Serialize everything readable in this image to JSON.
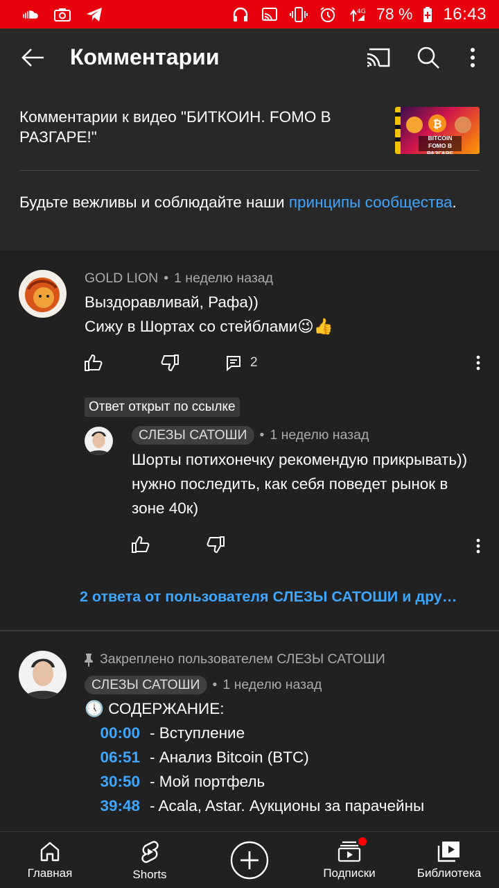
{
  "status_bar": {
    "battery": "78 %",
    "time": "16:43",
    "icons": [
      "soundcloud-icon",
      "camera-icon",
      "telegram-icon",
      "headphones-icon",
      "cast-icon",
      "vibrate-icon",
      "alarm-icon",
      "signal-4g-icon",
      "battery-charging-icon"
    ]
  },
  "app_bar": {
    "title": "Комментарии",
    "icons": [
      "back-arrow-icon",
      "cast-icon",
      "search-icon",
      "more-vert-icon"
    ]
  },
  "header": {
    "video_title": "Комментарии к видео \"БИТКОИН. FOMO В РАЗГАРЕ!\"",
    "thumbnail_text": "BITCOIN FOMO В РАЗГАРЕ",
    "rules_prefix": "Будьте вежливы и соблюдайте наши ",
    "rules_link": "принципы сообщества",
    "rules_suffix": "."
  },
  "comments": [
    {
      "author": "GOLD LION",
      "time": "1 неделю назад",
      "lines": [
        "Выздоравливай, Рафа))",
        "Сижу в Шортах со стейблами😉👍"
      ],
      "reply_count": "2"
    }
  ],
  "linked_badge": "Ответ открыт по ссылке",
  "reply": {
    "author": "СЛЕЗЫ САТОШИ",
    "time": "1 неделю назад",
    "text": "Шорты потихонечку рекомендую прикрывать)) нужно последить, как себя поведет рынок в зоне 40к)"
  },
  "replies_link": "2 ответа от пользователя СЛЕЗЫ САТОШИ и дру…",
  "pinned": {
    "pinned_label": "Закреплено пользователем СЛЕЗЫ САТОШИ",
    "author": "СЛЕЗЫ САТОШИ",
    "time": "1 неделю назад",
    "heading": "🕔 СОДЕРЖАНИЕ:",
    "timestamps": [
      {
        "time": "00:00",
        "label": "- Вступление"
      },
      {
        "time": "06:51",
        "label": "- Анализ Bitcoin (BTC)"
      },
      {
        "time": "30:50",
        "label": "- Мой портфель"
      },
      {
        "time": "39:48",
        "label": "- Acala, Astar. Аукционы за парачейны"
      }
    ]
  },
  "bottom_nav": [
    {
      "label": "Главная",
      "icon": "home-icon"
    },
    {
      "label": "Shorts",
      "icon": "shorts-icon"
    },
    {
      "label": "",
      "icon": "create-icon"
    },
    {
      "label": "Подписки",
      "icon": "subscriptions-icon"
    },
    {
      "label": "Библиотека",
      "icon": "library-icon"
    }
  ]
}
